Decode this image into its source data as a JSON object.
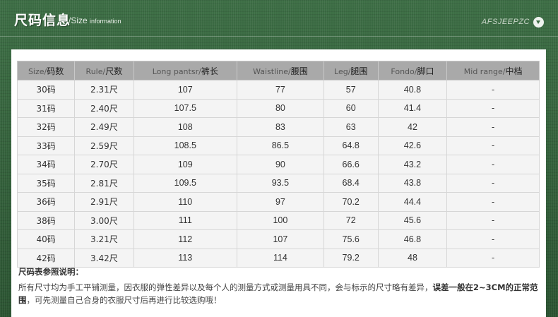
{
  "header": {
    "title": "尺码信息",
    "subtitle_slash": "/Size ",
    "subtitle_small": "information",
    "brand": "AFSJEEPZC"
  },
  "table": {
    "headers": [
      {
        "en": "Size/",
        "cn": "码数"
      },
      {
        "en": "Rule/",
        "cn": "尺数"
      },
      {
        "en": "Long pantsr/",
        "cn": "裤长"
      },
      {
        "en": "Waistline/",
        "cn": "腰围"
      },
      {
        "en": "Leg/",
        "cn": "腿围"
      },
      {
        "en": "Fondo/",
        "cn": "脚口"
      },
      {
        "en": "Mid range/",
        "cn": "中档"
      }
    ],
    "rows": [
      [
        "30码",
        "2.31尺",
        "107",
        "77",
        "57",
        "40.8",
        "-"
      ],
      [
        "31码",
        "2.40尺",
        "107.5",
        "80",
        "60",
        "41.4",
        "-"
      ],
      [
        "32码",
        "2.49尺",
        "108",
        "83",
        "63",
        "42",
        "-"
      ],
      [
        "33码",
        "2.59尺",
        "108.5",
        "86.5",
        "64.8",
        "42.6",
        "-"
      ],
      [
        "34码",
        "2.70尺",
        "109",
        "90",
        "66.6",
        "43.2",
        "-"
      ],
      [
        "35码",
        "2.81尺",
        "109.5",
        "93.5",
        "68.4",
        "43.8",
        "-"
      ],
      [
        "36码",
        "2.91尺",
        "110",
        "97",
        "70.2",
        "44.4",
        "-"
      ],
      [
        "38码",
        "3.00尺",
        "111",
        "100",
        "72",
        "45.6",
        "-"
      ],
      [
        "40码",
        "3.21尺",
        "112",
        "107",
        "75.6",
        "46.8",
        "-"
      ],
      [
        "42码",
        "3.42尺",
        "113",
        "114",
        "79.2",
        "48",
        "-"
      ]
    ]
  },
  "notes": {
    "heading": "尺码表参照说明：",
    "body": "所有尺寸均为手工平铺测量，因衣服的弹性差异以及每个人的测量方式或测量用具不同，会与标示的尺寸略有差异，",
    "emphasis": "误差一般在2~3CM的正常范围",
    "tail": "，可先测量自己合身的衣服尺寸后再进行比较选购哦！"
  }
}
